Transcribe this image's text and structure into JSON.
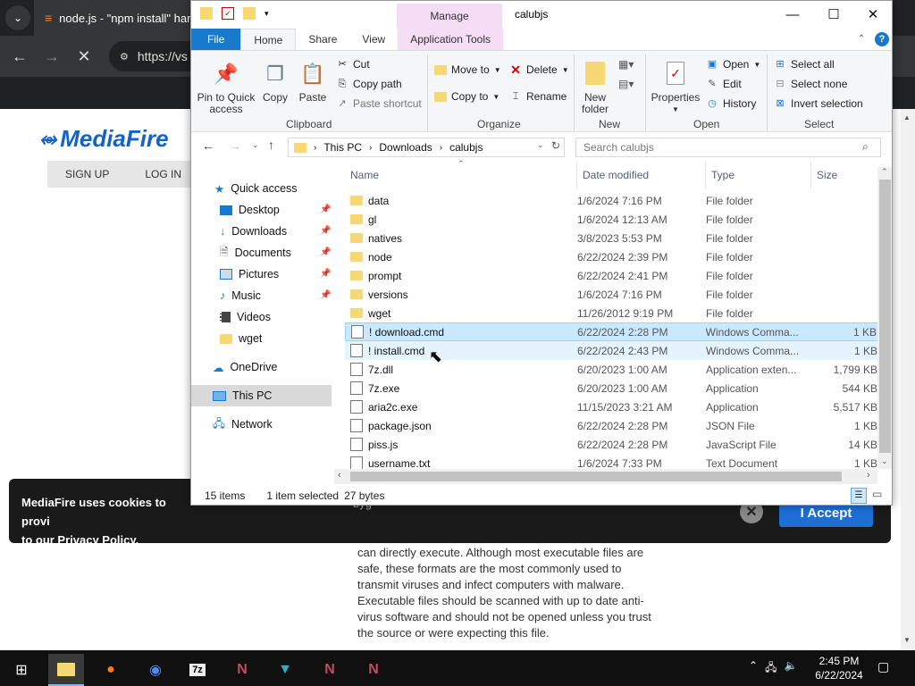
{
  "browser": {
    "tab_title": "node.js - \"npm install\" har",
    "url_partial": "https://vs"
  },
  "mediafire": {
    "logo": "MediaFire",
    "nav": [
      "SIGN UP",
      "LOG IN"
    ],
    "cookie_text": "MediaFire uses cookies to provi\nto our Privacy Policy.",
    "cookie_prefix": "byg",
    "accept": "I Accept",
    "warning_text": "can directly execute. Although most executable files are safe, these formats are the most commonly used to transmit viruses and infect computers with malware. Executable files should be scanned with up to date anti-virus software and should not be opened unless you trust the source or were expecting this file."
  },
  "explorer": {
    "title": "calubjs",
    "manage": "Manage",
    "tabs": [
      "File",
      "Home",
      "Share",
      "View",
      "Application Tools"
    ],
    "ribbon": {
      "pin": "Pin to Quick access",
      "copy": "Copy",
      "paste": "Paste",
      "cut": "Cut",
      "copy_path": "Copy path",
      "paste_shortcut": "Paste shortcut",
      "clipboard": "Clipboard",
      "move_to": "Move to",
      "copy_to": "Copy to",
      "delete": "Delete",
      "rename": "Rename",
      "organize": "Organize",
      "new_folder": "New folder",
      "new": "New",
      "properties": "Properties",
      "open": "Open",
      "edit": "Edit",
      "history": "History",
      "open_group": "Open",
      "select_all": "Select all",
      "select_none": "Select none",
      "invert_selection": "Invert selection",
      "select": "Select"
    },
    "breadcrumb": [
      "This PC",
      "Downloads",
      "calubjs"
    ],
    "search_placeholder": "Search calubjs",
    "nav": {
      "quick_access": "Quick access",
      "items": [
        "Desktop",
        "Downloads",
        "Documents",
        "Pictures",
        "Music",
        "Videos",
        "wget"
      ],
      "onedrive": "OneDrive",
      "this_pc": "This PC",
      "network": "Network"
    },
    "columns": [
      "Name",
      "Date modified",
      "Type",
      "Size"
    ],
    "files": [
      {
        "name": "data",
        "date": "1/6/2024 7:16 PM",
        "type": "File folder",
        "size": ""
      },
      {
        "name": "gl",
        "date": "1/6/2024 12:13 AM",
        "type": "File folder",
        "size": ""
      },
      {
        "name": "natives",
        "date": "3/8/2023 5:53 PM",
        "type": "File folder",
        "size": ""
      },
      {
        "name": "node",
        "date": "6/22/2024 2:39 PM",
        "type": "File folder",
        "size": ""
      },
      {
        "name": "prompt",
        "date": "6/22/2024 2:41 PM",
        "type": "File folder",
        "size": ""
      },
      {
        "name": "versions",
        "date": "1/6/2024 7:16 PM",
        "type": "File folder",
        "size": ""
      },
      {
        "name": "wget",
        "date": "11/26/2012 9:19 PM",
        "type": "File folder",
        "size": ""
      },
      {
        "name": "! download.cmd",
        "date": "6/22/2024 2:28 PM",
        "type": "Windows Comma...",
        "size": "1 KB"
      },
      {
        "name": "! install.cmd",
        "date": "6/22/2024 2:43 PM",
        "type": "Windows Comma...",
        "size": "1 KB"
      },
      {
        "name": "7z.dll",
        "date": "6/20/2023 1:00 AM",
        "type": "Application exten...",
        "size": "1,799 KB"
      },
      {
        "name": "7z.exe",
        "date": "6/20/2023 1:00 AM",
        "type": "Application",
        "size": "544 KB"
      },
      {
        "name": "aria2c.exe",
        "date": "11/15/2023 3:21 AM",
        "type": "Application",
        "size": "5,517 KB"
      },
      {
        "name": "package.json",
        "date": "6/22/2024 2:28 PM",
        "type": "JSON File",
        "size": "1 KB"
      },
      {
        "name": "piss.js",
        "date": "6/22/2024 2:28 PM",
        "type": "JavaScript File",
        "size": "14 KB"
      },
      {
        "name": "username.txt",
        "date": "1/6/2024 7:33 PM",
        "type": "Text Document",
        "size": "1 KB"
      }
    ],
    "status": {
      "count": "15 items",
      "selected": "1 item selected",
      "bytes": "27 bytes"
    }
  },
  "taskbar": {
    "time": "2:45 PM",
    "date": "6/22/2024"
  }
}
